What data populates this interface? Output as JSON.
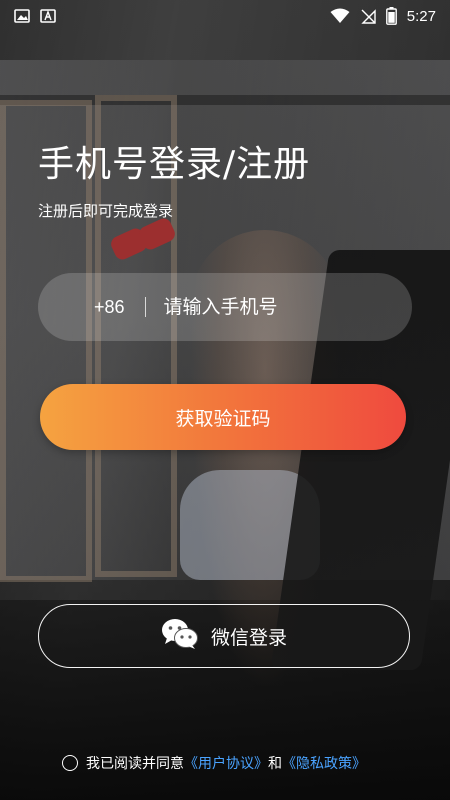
{
  "status_bar": {
    "time": "5:27",
    "icons": [
      "image-icon",
      "a-icon",
      "wifi-icon",
      "no-sim-icon",
      "battery-icon"
    ]
  },
  "login": {
    "title": "手机号登录/注册",
    "subtitle": "注册后即可完成登录",
    "country_code": "+86",
    "phone_placeholder": "请输入手机号",
    "code_button_label": "获取验证码",
    "wechat_label": "微信登录"
  },
  "agreement": {
    "prefix": "我已阅读并同意",
    "user_agreement": "《用户协议》",
    "conjunction": "和",
    "privacy_policy": "《隐私政策》"
  },
  "colors": {
    "button_gradient_start": "#f5a340",
    "button_gradient_end": "#ef4a3e",
    "link": "#4aa3ff"
  }
}
